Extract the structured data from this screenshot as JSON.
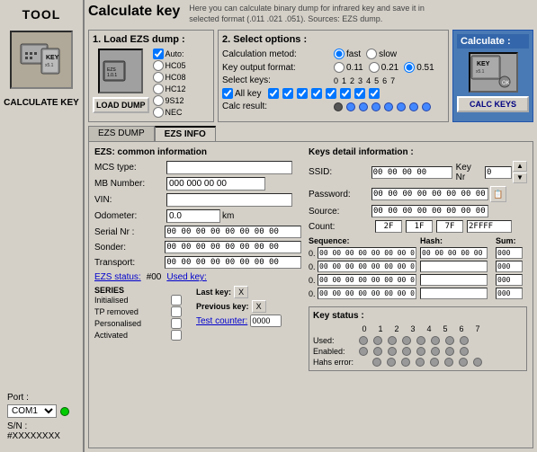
{
  "sidebar": {
    "title": "TOOL",
    "icon_label": "CALCULATE KEY",
    "port_label": "Port :",
    "com_value": "COM1",
    "sn_label": "S/N : #XXXXXXXX"
  },
  "header": {
    "title": "Calculate key",
    "description": "Here you can calculate binary dump for infrared key and save it in selected format (.011 .021 .051). Sources: EZS dump."
  },
  "load_panel": {
    "title": "1. Load EZS dump :",
    "auto_label": "Auto:",
    "options": [
      "HC05",
      "HC08",
      "HC12",
      "9S12",
      "NEC"
    ],
    "button_label": "LOAD DUMP"
  },
  "select_options_panel": {
    "title": "2. Select options :",
    "calc_method_label": "Calculation metod:",
    "fast_label": "fast",
    "slow_label": "slow",
    "key_output_label": "Key output format:",
    "format_011": "0.11",
    "format_021": "0.21",
    "format_051": "0.51",
    "select_keys_label": "Select keys:",
    "nums": [
      "0",
      "1",
      "2",
      "3",
      "4",
      "5",
      "6",
      "7"
    ],
    "all_key_label": "All key",
    "calc_result_label": "Calc result:"
  },
  "calc_panel": {
    "title": "Calculate :",
    "button_label": "CALC KEYS"
  },
  "tabs": [
    {
      "label": "EZS DUMP",
      "active": false
    },
    {
      "label": "EZS INFO",
      "active": true
    }
  ],
  "ezs_info": {
    "section_title": "EZS: common information",
    "mcs_type_label": "MCS type:",
    "mcs_type_value": "",
    "mb_number_label": "MB Number:",
    "mb_number_value": "000 000 00 00",
    "vin_label": "VIN:",
    "vin_value": "",
    "odometer_label": "Odometer:",
    "odometer_value": "0.0",
    "km_label": "km",
    "serial_nr_label": "Serial Nr :",
    "serial_nr_value": "00 00 00 00 00 00 00 00",
    "sonder_label": "Sonder:",
    "sonder_value": "00 00 00 00 00 00 00 00",
    "transport_label": "Transport:",
    "transport_value": "00 00 00 00 00 00 00 00",
    "ezs_status_label": "EZS status:",
    "ezs_status_value": "#00",
    "used_key_label": "Used key:",
    "series_label": "SERIES",
    "last_key_label": "Last key:",
    "prev_key_label": "Previous key:",
    "test_counter_label": "Test counter:",
    "test_counter_value": "0000",
    "series_rows": [
      {
        "name": "Initialised",
        "checked": false
      },
      {
        "name": "TP removed",
        "checked": false
      },
      {
        "name": "Personalised",
        "checked": false
      },
      {
        "name": "Activated",
        "checked": false
      }
    ]
  },
  "keys_detail": {
    "title": "Keys detail information :",
    "ssid_label": "SSID:",
    "ssid_value": "00 00 00 00",
    "key_nr_label": "Key Nr",
    "key_nr_value": "0",
    "password_label": "Password:",
    "password_value": "00 00 00 00 00 00 00 00 00 00",
    "source_label": "Source:",
    "source_value": "00 00 00 00 00 00 00 00 00 00",
    "count_label": "Count:",
    "count_2f": "2F",
    "count_1f": "1F",
    "count_7f": "7F",
    "count_2ffff": "2FFFF",
    "sequence_label": "Sequence:",
    "hash_label": "Hash:",
    "sum_label": "Sum:",
    "seq_rows": [
      {
        "num": "0.",
        "seq_val": "00 00 00 00 00 00 00 00 00 00",
        "hash_val": "00 00 00 00 00 00 00",
        "sum_val": "000"
      },
      {
        "num": "0.",
        "seq_val": "00 00 00 00 00 00 00 00 00 00",
        "hash_val": "",
        "sum_val": "000"
      },
      {
        "num": "0.",
        "seq_val": "00 00 00 00 00 00 00 00 00 00",
        "hash_val": "",
        "sum_val": "000"
      },
      {
        "num": "0.",
        "seq_val": "00 00 00 00 00 00 00 00 00 00",
        "hash_val": "",
        "sum_val": "000"
      }
    ]
  },
  "key_status": {
    "title": "Key status :",
    "num_labels": [
      "0",
      "1",
      "2",
      "3",
      "4",
      "5",
      "6",
      "7"
    ],
    "used_label": "Used:",
    "enabled_label": "Enabled:",
    "hash_error_label": "Hahs error:"
  }
}
